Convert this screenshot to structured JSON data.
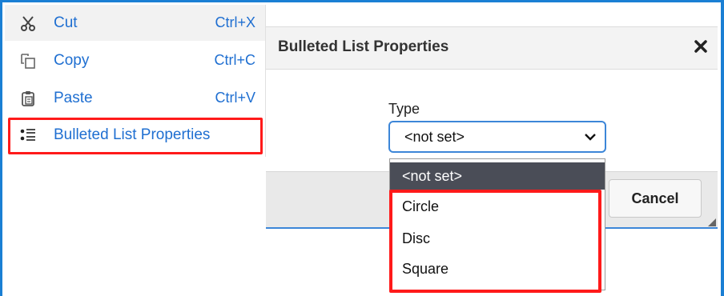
{
  "context_menu": {
    "items": [
      {
        "label": "Cut",
        "shortcut": "Ctrl+X",
        "icon": "scissors-icon"
      },
      {
        "label": "Copy",
        "shortcut": "Ctrl+C",
        "icon": "copy-icon"
      },
      {
        "label": "Paste",
        "shortcut": "Ctrl+V",
        "icon": "paste-icon"
      },
      {
        "label": "Bulleted List Properties",
        "shortcut": "",
        "icon": "bulleted-list-icon"
      }
    ]
  },
  "dialog": {
    "title": "Bulleted List Properties",
    "type_label": "Type",
    "type_value": "<not set>",
    "cancel_label": "Cancel"
  },
  "dropdown": {
    "options": [
      "<not set>",
      "Circle",
      "Disc",
      "Square"
    ],
    "selected": "<not set>"
  },
  "colors": {
    "frame": "#1a7fd4",
    "menu_text": "#1f6fd1",
    "highlight": "#ff1a1a",
    "selected_option_bg": "#4a4d57"
  }
}
